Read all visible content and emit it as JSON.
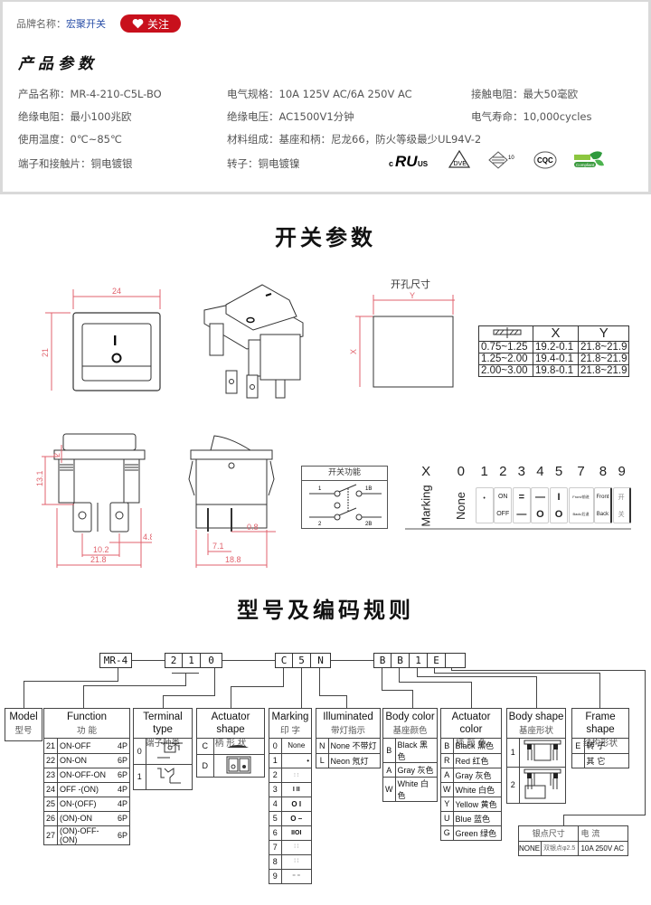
{
  "card": {
    "brand_label": "品牌名称：",
    "brand_name": "宏聚开关",
    "follow_label": "关注",
    "section_title": "产品参数",
    "params": [
      {
        "label": "产品名称：",
        "value": "MR-4-210-C5L-BO"
      },
      {
        "label": "电气规格：",
        "value": "10A  125V  AC/6A 250V  AC"
      },
      {
        "label": "接触电阻：",
        "value": "最大50毫欧"
      },
      {
        "label": "绝缘电阻：",
        "value": "最小100兆欧"
      },
      {
        "label": "绝缘电压：",
        "value": "AC1500V1分钟"
      },
      {
        "label": "电气寿命：",
        "value": "10,000cycles"
      },
      {
        "label": "使用温度：",
        "value": "0℃~85℃"
      },
      {
        "label": "材料组成：",
        "value": "基座和柄：尼龙66，防火等级最少UL94V-2"
      },
      {
        "label": "端子和接触片：",
        "value": "铜电镀银"
      },
      {
        "label": "转子：",
        "value": "铜电镀镍"
      }
    ],
    "certifications": [
      "cULus",
      "VDE",
      "ENEC 10",
      "CQC",
      "RoHS Compliant"
    ]
  },
  "switch_params": {
    "title": "开关参数",
    "front_view": {
      "width": "24",
      "height": "21",
      "marks": [
        "I",
        "O"
      ]
    },
    "cutout": {
      "title": "开孔尺寸",
      "x_label": "X",
      "y_label": "Y",
      "table": {
        "headers": [
          "",
          "X",
          "Y"
        ],
        "rows": [
          [
            "0.75~1.25",
            "19.2-0.1",
            "21.8~21.9"
          ],
          [
            "1.25~2.00",
            "19.4-0.1",
            "21.8~21.9"
          ],
          [
            "2.00~3.00",
            "19.8-0.1",
            "21.8~21.9"
          ]
        ]
      }
    },
    "side_view": {
      "d2": "2",
      "d13_1": "13.1",
      "d4_8": "4.8",
      "d10_2": "10.2",
      "d21_8": "21.8"
    },
    "end_view": {
      "d0_8": "0.8",
      "d7_1": "7.1",
      "d18_8": "18.8"
    },
    "function_diagram": {
      "title": "开关功能",
      "pins": [
        "1",
        "1B",
        "2",
        "2B"
      ]
    },
    "marking_table": {
      "row_label_x": "X",
      "row_label": "Marking",
      "codes": [
        "0",
        "1",
        "2",
        "3",
        "4",
        "5",
        "7",
        "8",
        "9"
      ],
      "cells": [
        {
          "top": "None",
          "bottom": ""
        },
        {
          "top": "•",
          "bottom": ""
        },
        {
          "top": "ON",
          "bottom": "OFF"
        },
        {
          "top": "=",
          "bottom": "—"
        },
        {
          "top": "—",
          "bottom": "O"
        },
        {
          "top": "I",
          "bottom": "O"
        },
        {
          "top": "Front/前进",
          "bottom": "Back/后退"
        },
        {
          "top": "Front",
          "bottom": "Back"
        },
        {
          "top": "开",
          "bottom": "关"
        }
      ]
    }
  },
  "coding": {
    "title": "型号及编码规则",
    "code_parts": [
      "MR-4",
      "2",
      "1",
      "0",
      "C",
      "5",
      "N",
      "B",
      "B",
      "1",
      "E",
      ""
    ],
    "model": {
      "en": "Model",
      "cn": "型号"
    },
    "function": {
      "en": "Function",
      "cn": "功  能",
      "rows": [
        [
          "21",
          "ON-OFF",
          "4P"
        ],
        [
          "22",
          "ON-ON",
          "6P"
        ],
        [
          "23",
          "ON-OFF-ON",
          "6P"
        ],
        [
          "24",
          "OFF -(ON)",
          "4P"
        ],
        [
          "25",
          "ON-(OFF)",
          "4P"
        ],
        [
          "26",
          "(ON)-ON",
          "6P"
        ],
        [
          "27",
          "(ON)-OFF-(ON)",
          "6P"
        ]
      ]
    },
    "terminal": {
      "en": "Terminal type",
      "cn": "端子种类",
      "rows": [
        "0",
        "1"
      ]
    },
    "actuator_shape": {
      "en": "Actuator shape",
      "cn": "柄 形 状",
      "rows": [
        "C",
        "D"
      ]
    },
    "marking": {
      "en": "Marking",
      "cn": "印  字",
      "rows": [
        "0",
        "1",
        "2",
        "3",
        "4",
        "5",
        "6",
        "7",
        "8",
        "9"
      ],
      "none_label": "None"
    },
    "illuminated": {
      "en": "Illuminated",
      "cn": "带灯指示",
      "rows": [
        [
          "N",
          "None 不带灯"
        ],
        [
          "L",
          "Neon  氖灯"
        ]
      ]
    },
    "body_color": {
      "en": "Body color",
      "cn": "基座颜色",
      "rows": [
        [
          "B",
          "Black 黑色"
        ],
        [
          "A",
          "Gray 灰色"
        ],
        [
          "W",
          "White 白色"
        ]
      ]
    },
    "actuator_color": {
      "en": "Actuator color",
      "cn": "柄 颜 色",
      "rows": [
        [
          "B",
          "Black 黑色"
        ],
        [
          "R",
          "Red   红色"
        ],
        [
          "A",
          "Gray 灰色"
        ],
        [
          "W",
          "White 白色"
        ],
        [
          "Y",
          "Yellow 黄色"
        ],
        [
          "U",
          "Blue  蓝色"
        ],
        [
          "G",
          "Green 绿色"
        ]
      ]
    },
    "body_shape": {
      "en": "Body shape",
      "cn": "基座形状",
      "rows": [
        "1",
        "2"
      ]
    },
    "frame_shape": {
      "en": "Frame shape",
      "cn": "结构形状",
      "rows": [
        [
          "E",
          "转  子"
        ],
        [
          "",
          "其  它"
        ]
      ]
    },
    "contact": {
      "h1": "银点尺寸",
      "h2": "电  流",
      "row": [
        "NONE",
        "双银点φ2.5",
        "10A 250V AC"
      ]
    }
  }
}
